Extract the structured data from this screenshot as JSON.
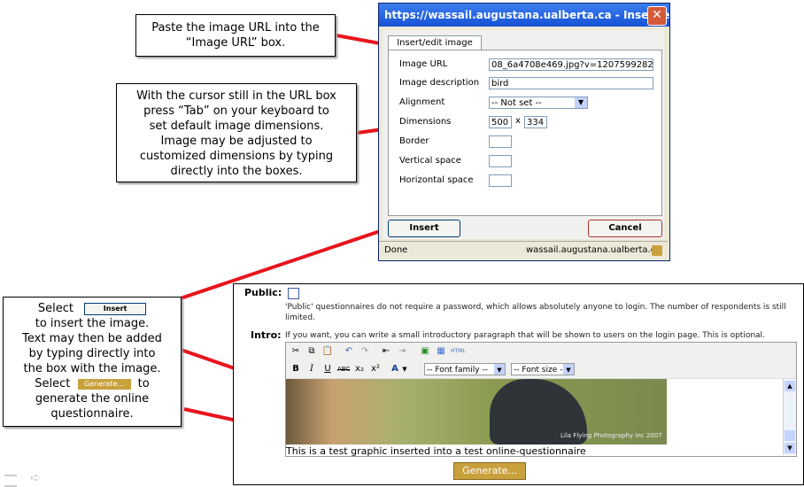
{
  "callouts": {
    "paste_url": {
      "line1": "Paste the image URL into the",
      "line2": "“Image URL” box."
    },
    "tab": {
      "lines": [
        "With the cursor still in the URL box",
        "press “Tab” on your keyboard to",
        "set default image dimensions.",
        "Image may be adjusted to",
        "customized dimensions by typing",
        "directly into the boxes."
      ]
    },
    "insert": {
      "select1": "Select",
      "insert_btn": "Insert",
      "line2": "to insert the image.",
      "line3": "Text may then be added",
      "line4": "by typing directly into",
      "line5": "the box with the image.",
      "select2": "Select",
      "generate_btn": "Generate...",
      "to": "to",
      "line7": "generate the online",
      "line8": "questionnaire."
    }
  },
  "dialog": {
    "title": "https://wassail.augustana.ualberta.ca - Insert/edi...",
    "close": "✕",
    "tab": "Insert/edit image",
    "fields": {
      "image_url_label": "Image URL",
      "image_url_value": "08_6a4708e469.jpg?v=1207599282",
      "description_label": "Image description",
      "description_value": "bird",
      "alignment_label": "Alignment",
      "alignment_value": "-- Not set --",
      "dimensions_label": "Dimensions",
      "width": "500",
      "x": "x",
      "height": "334",
      "border_label": "Border",
      "vspace_label": "Vertical space",
      "hspace_label": "Horizontal space"
    },
    "insert_button": "Insert",
    "cancel_button": "Cancel",
    "status_left": "Done",
    "status_right": "wassail.augustana.ualberta.ca"
  },
  "questionnaire": {
    "public_label": "Public:",
    "public_note": "'Public' questionnaires do not require a password, which allows absolutely anyone to login. The number of respondents is still limited.",
    "intro_label": "Intro:",
    "intro_note": "If you want, you can write a small introductory paragraph that will be shown to users on the login page. This is optional.",
    "font_family": "-- Font family --",
    "font_size": "-- Font size --",
    "editor_text": "This is a test graphic inserted into a test online-questionnaire",
    "watermark": "Lila Flying Photography Inc 2007",
    "generate_button": "Generate..."
  },
  "colors": {
    "arrow": "#e8141c",
    "generate": "#c8a13c",
    "title_bar": "#2a64dc"
  }
}
